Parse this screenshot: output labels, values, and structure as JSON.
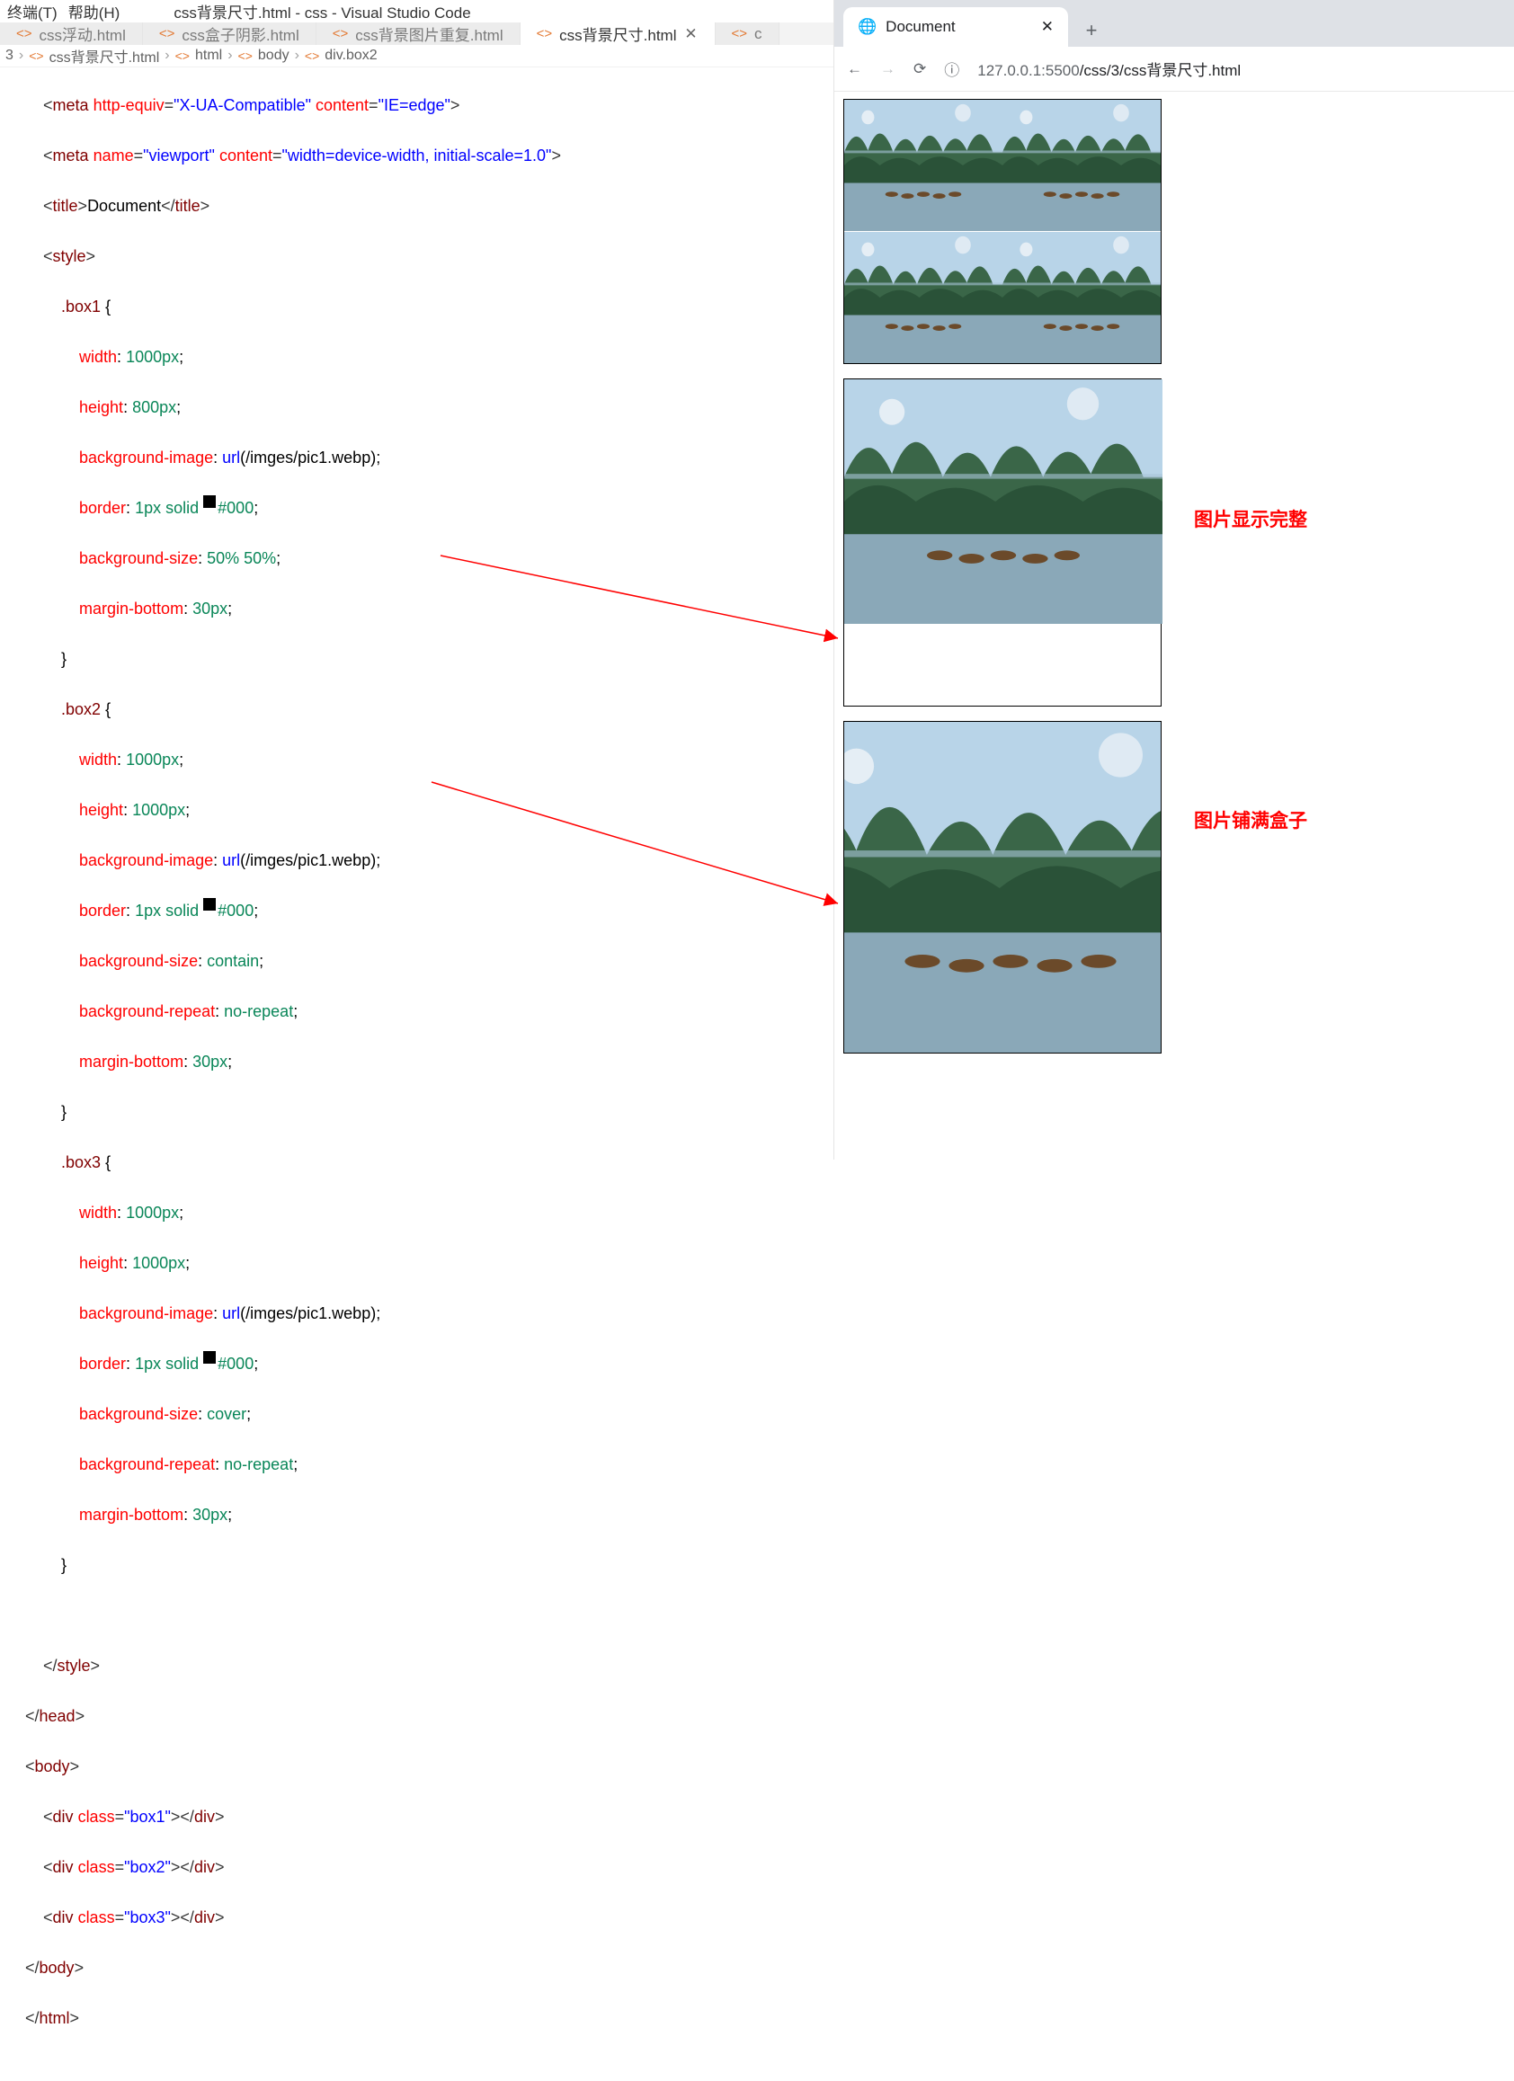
{
  "titlebar": {
    "menu_terminal": "终端(T)",
    "menu_help": "帮助(H)",
    "title": "css背景尺寸.html - css - Visual Studio Code"
  },
  "tabs": [
    {
      "label": "css浮动.html",
      "active": false
    },
    {
      "label": "css盒子阴影.html",
      "active": false
    },
    {
      "label": "css背景图片重复.html",
      "active": false
    },
    {
      "label": "css背景尺寸.html",
      "active": true
    },
    {
      "label": "c",
      "active": false
    }
  ],
  "breadcrumb": {
    "seg0": "3",
    "seg1": "css背景尺寸.html",
    "seg2": "html",
    "seg3": "body",
    "seg4": "div.box2"
  },
  "code": {
    "l1": "    <meta http-equiv=\"X-UA-Compatible\" content=\"IE=edge\">",
    "l2": "    <meta name=\"viewport\" content=\"width=device-width, initial-scale=1.0\">",
    "l3": "    <title>Document</title>",
    "l4": "    <style>",
    "l5": "        .box1 {",
    "l6": "            width: 1000px;",
    "l7": "            height: 800px;",
    "l8": "            background-image: url(/imges/pic1.webp);",
    "l9": "            border: 1px solid ■#000;",
    "l10": "            background-size: 50% 50%;",
    "l11": "            margin-bottom: 30px;",
    "l12": "        }",
    "l13": "        .box2 {",
    "l14": "            width: 1000px;",
    "l15": "            height: 1000px;",
    "l16": "            background-image: url(/imges/pic1.webp);",
    "l17": "            border: 1px solid ■#000;",
    "l18": "            background-size: contain;",
    "l19": "            background-repeat: no-repeat;",
    "l20": "            margin-bottom: 30px;",
    "l21": "        }",
    "l22": "        .box3 {",
    "l23": "            width: 1000px;",
    "l24": "            height: 1000px;",
    "l25": "            background-image: url(/imges/pic1.webp);",
    "l26": "            border: 1px solid ■#000;",
    "l27": "            background-size: cover;",
    "l28": "            background-repeat: no-repeat;",
    "l29": "            margin-bottom: 30px;",
    "l30": "        }",
    "l31": "",
    "l32": "    </style>",
    "l33": "</head>",
    "l34": "<body>",
    "l35": "    <div class=\"box1\"></div>",
    "l36": "    <div class=\"box2\"></div>",
    "l37": "    <div class=\"box3\"></div>",
    "l38": "</body>",
    "l39": "</html>"
  },
  "browser": {
    "tab_title": "Document",
    "url_prefix": "127.0.0.1:5500",
    "url_path": "/css/3/css背景尺寸.html"
  },
  "annotations": {
    "a1": "图片显示完整",
    "a2": "图片铺满盒子"
  }
}
